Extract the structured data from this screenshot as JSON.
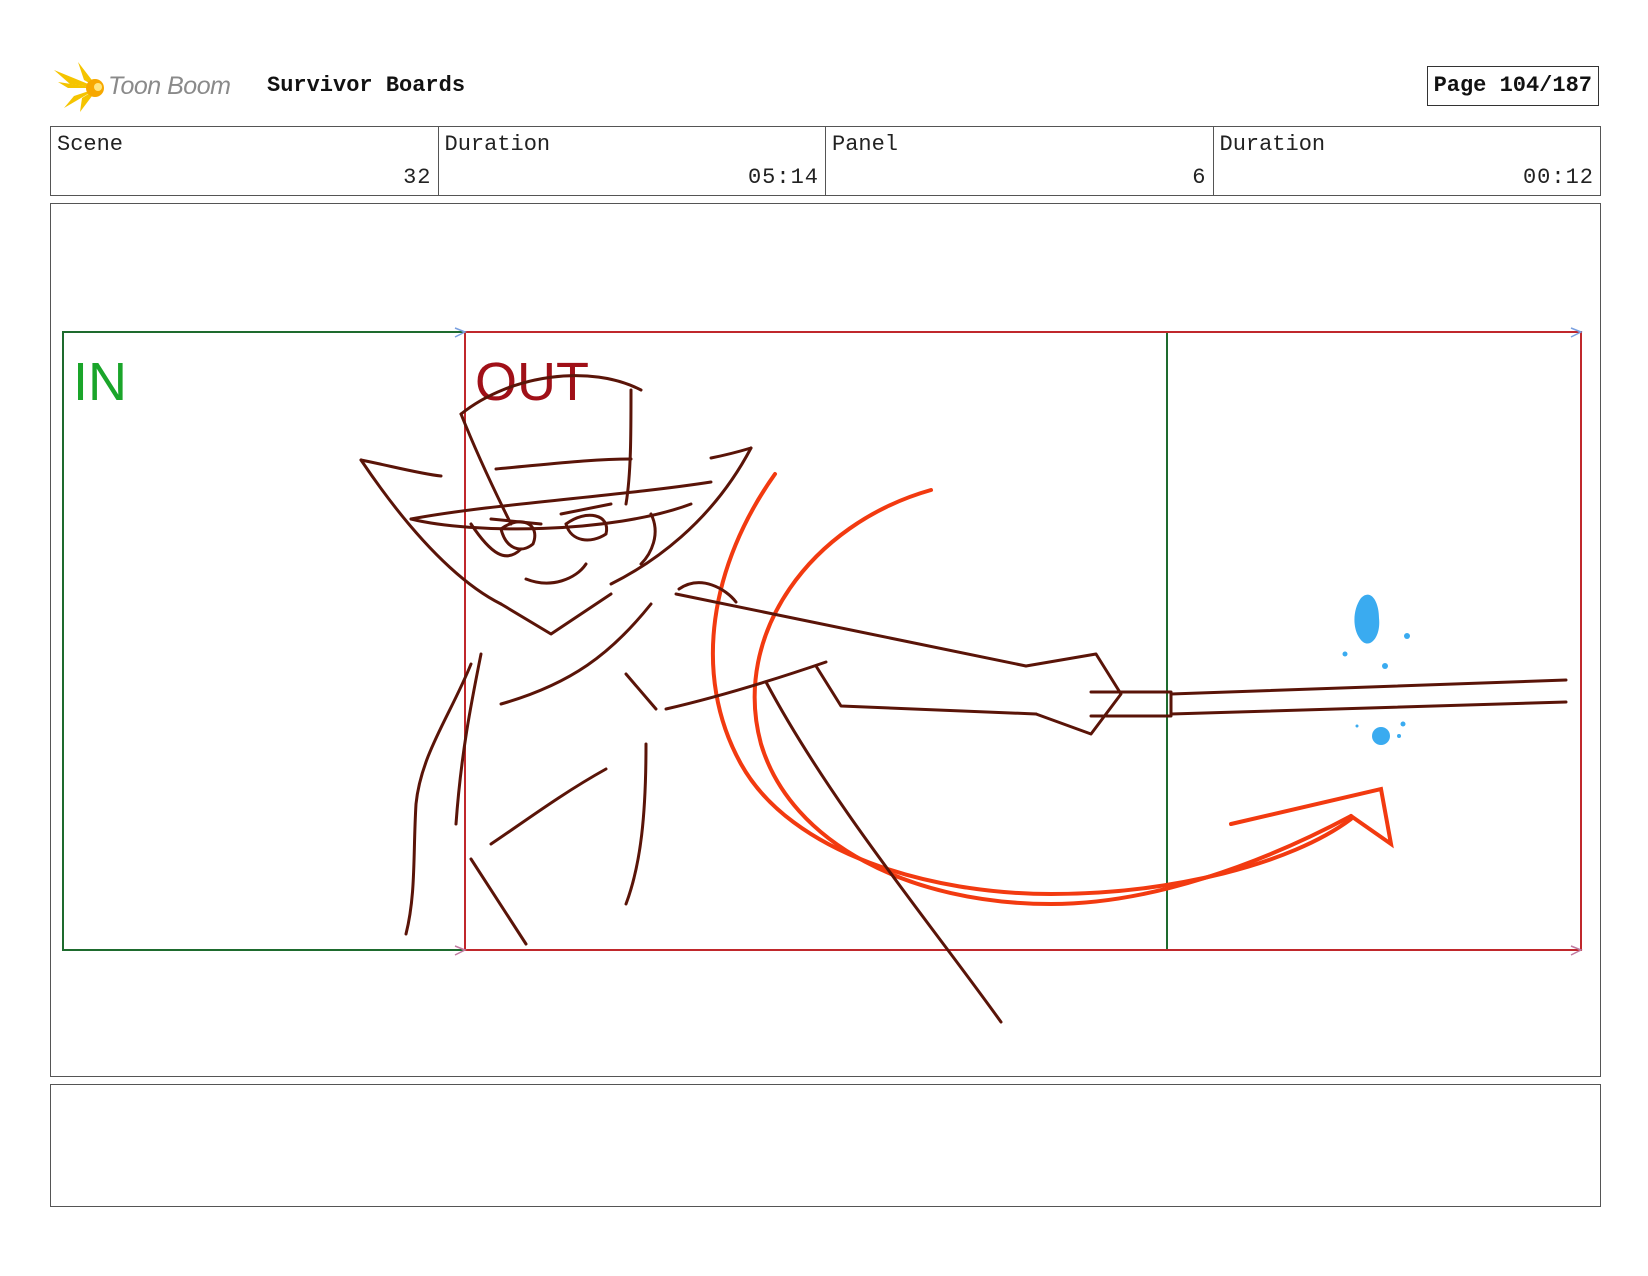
{
  "header": {
    "logo_text": "Toon Boom",
    "board_title": "Survivor Boards",
    "page_label": "Page 104/187"
  },
  "info": [
    {
      "label": "Scene",
      "value": "32"
    },
    {
      "label": "Duration",
      "value": "05:14"
    },
    {
      "label": "Panel",
      "value": "6"
    },
    {
      "label": "Duration",
      "value": "00:12"
    }
  ],
  "panel": {
    "in_label": "IN",
    "out_label": "OUT"
  },
  "colors": {
    "in_frame": "#1e6b2e",
    "in_text": "#1aa52a",
    "out_frame": "#c0282c",
    "out_text": "#a01018",
    "sketch": "#5a1408",
    "tail": "#f23a10",
    "splash": "#3aabf0"
  },
  "notes": {
    "text": ""
  }
}
